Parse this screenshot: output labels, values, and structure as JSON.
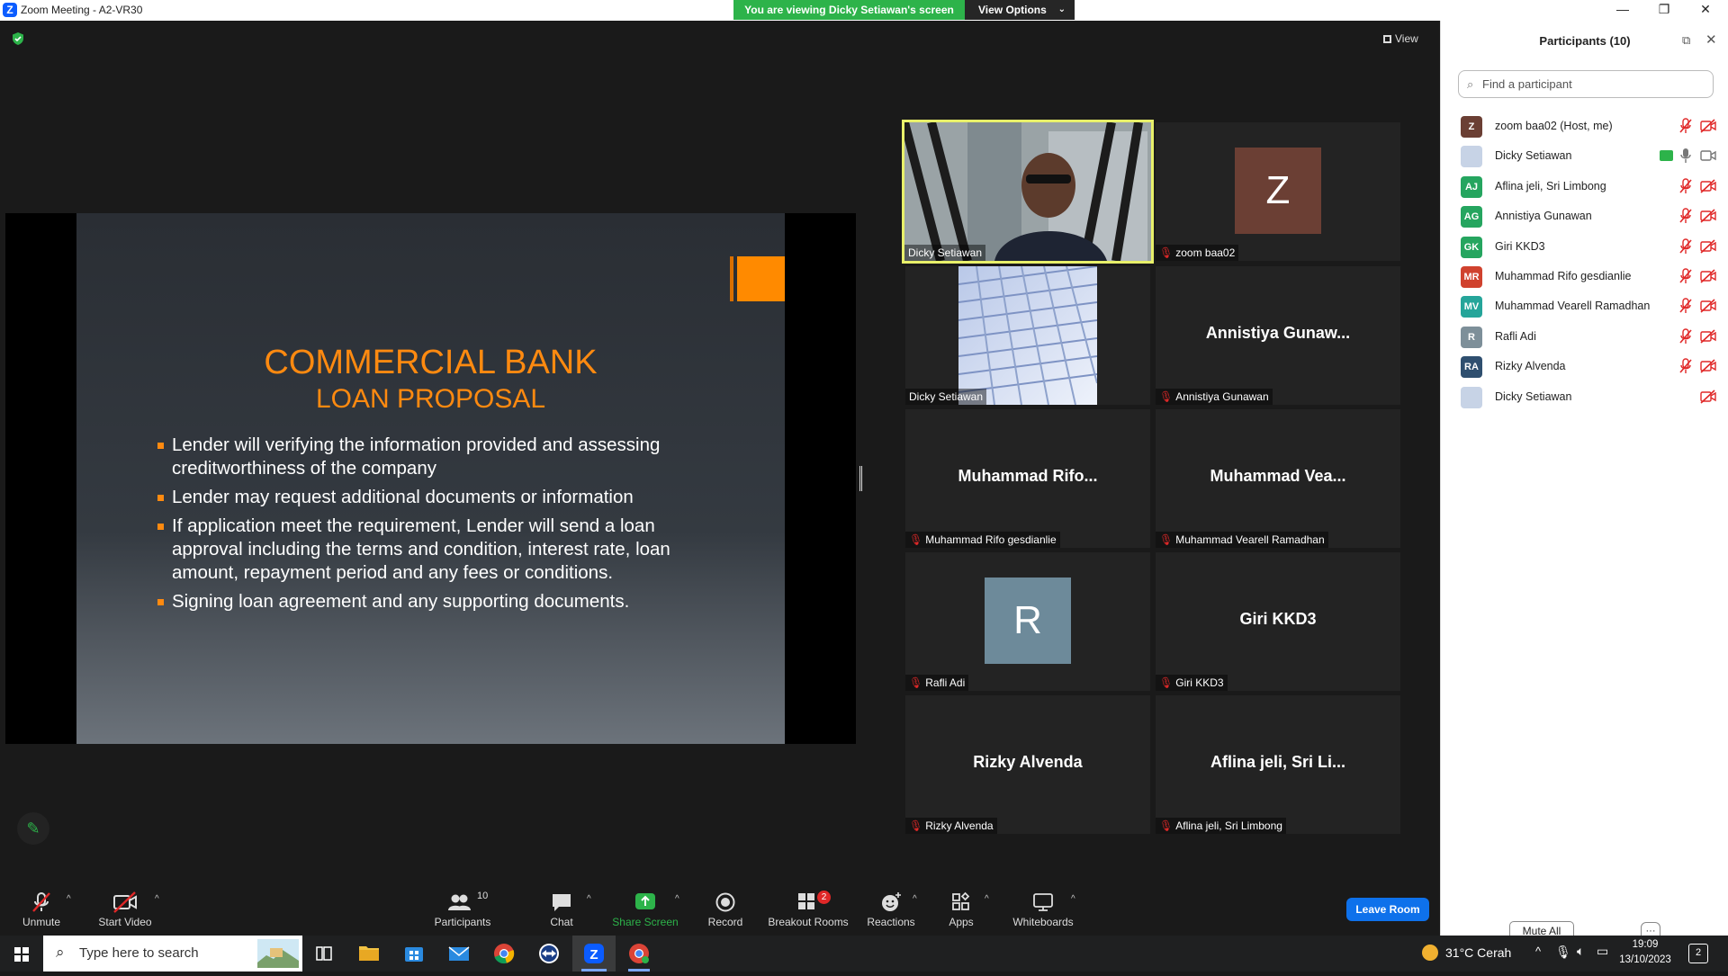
{
  "window": {
    "title": "Zoom Meeting - A2-VR30"
  },
  "banner": {
    "viewing": "You are viewing Dicky Setiawan's screen",
    "view_options": "View Options"
  },
  "stage": {
    "view_label": "View"
  },
  "slide": {
    "title": "COMMERCIAL BANK",
    "subtitle": "LOAN PROPOSAL",
    "bullets": [
      "Lender will verifying the information provided and assessing creditworthiness of the company",
      "Lender may request additional documents or information",
      "If application meet the requirement, Lender will send a loan approval including the terms and condition, interest rate, loan amount, repayment period and any fees or conditions.",
      "Signing loan agreement and any supporting documents."
    ]
  },
  "gallery": [
    {
      "name": "Dicky Setiawan",
      "display": "",
      "muted": false,
      "type": "video-person",
      "active": true
    },
    {
      "name": "zoom baa02",
      "display": "Z",
      "muted": true,
      "type": "avatar",
      "avatar_color": "#6b3f34"
    },
    {
      "name": "Dicky Setiawan",
      "display": "",
      "muted": false,
      "type": "video-building"
    },
    {
      "name": "Annistiya Gunawan",
      "display": "Annistiya  Gunaw...",
      "muted": true,
      "type": "text"
    },
    {
      "name": "Muhammad Rifo gesdianlie",
      "display": "Muhammad  Rifo...",
      "muted": true,
      "type": "text"
    },
    {
      "name": "Muhammad Vearell Ramadhan",
      "display": "Muhammad  Vea...",
      "muted": true,
      "type": "text"
    },
    {
      "name": "Rafli Adi",
      "display": "R",
      "muted": true,
      "type": "avatar",
      "avatar_color": "#6d8a9a"
    },
    {
      "name": "Giri KKD3",
      "display": "Giri KKD3",
      "muted": true,
      "type": "text"
    },
    {
      "name": "Rizky Alvenda",
      "display": "Rizky Alvenda",
      "muted": true,
      "type": "text"
    },
    {
      "name": "Aflina jeli, Sri Limbong",
      "display": "Aflina jeli,  Sri Li...",
      "muted": true,
      "type": "text"
    }
  ],
  "panel": {
    "title": "Participants (10)",
    "search_placeholder": "Find a participant",
    "participants": [
      {
        "initials": "Z",
        "name": "zoom baa02 (Host, me)",
        "color": "#6b3f34",
        "mic": "muted",
        "cam": "off"
      },
      {
        "initials": "",
        "name": "Dicky Setiawan",
        "color": "#c7d3e6",
        "mic": "on",
        "cam": "on",
        "sharing": true
      },
      {
        "initials": "AJ",
        "name": "Aflina jeli, Sri Limbong",
        "color": "#25a55f",
        "mic": "muted",
        "cam": "off"
      },
      {
        "initials": "AG",
        "name": "Annistiya Gunawan",
        "color": "#25a55f",
        "mic": "muted",
        "cam": "off"
      },
      {
        "initials": "GK",
        "name": "Giri KKD3",
        "color": "#25a55f",
        "mic": "muted",
        "cam": "off"
      },
      {
        "initials": "MR",
        "name": "Muhammad Rifo gesdianlie",
        "color": "#d0422e",
        "mic": "muted",
        "cam": "off"
      },
      {
        "initials": "MV",
        "name": "Muhammad Vearell Ramadhan",
        "color": "#25a59a",
        "mic": "muted",
        "cam": "off"
      },
      {
        "initials": "R",
        "name": "Rafli Adi",
        "color": "#7d8f99",
        "mic": "muted",
        "cam": "off"
      },
      {
        "initials": "RA",
        "name": "Rizky Alvenda",
        "color": "#2f4f6f",
        "mic": "muted",
        "cam": "off"
      },
      {
        "initials": "",
        "name": "Dicky Setiawan",
        "color": "#c7d3e6",
        "mic": "none",
        "cam": "off"
      }
    ],
    "mute_all": "Mute All",
    "more": "···"
  },
  "toolbar": {
    "unmute": "Unmute",
    "start_video": "Start Video",
    "participants": "Participants",
    "participants_count": "10",
    "chat": "Chat",
    "share_screen": "Share Screen",
    "record": "Record",
    "breakout_rooms": "Breakout Rooms",
    "breakout_badge": "2",
    "reactions": "Reactions",
    "apps": "Apps",
    "whiteboards": "Whiteboards",
    "leave_room": "Leave Room"
  },
  "taskbar": {
    "search_placeholder": "Type here to search",
    "weather": "31°C  Cerah",
    "time": "19:09",
    "date": "13/10/2023",
    "notif_count": "2"
  }
}
